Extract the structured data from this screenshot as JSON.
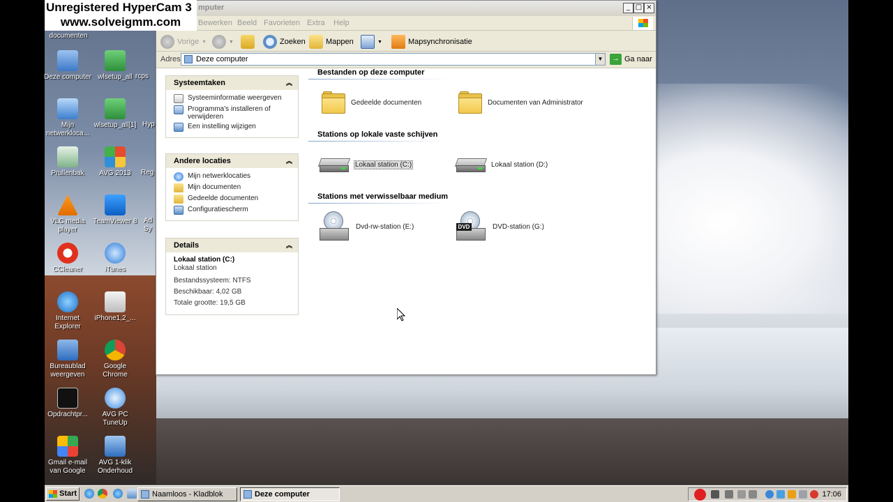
{
  "watermark": {
    "line1": "Unregistered HyperCam 3",
    "line2": "www.solveigmm.com"
  },
  "desktop": {
    "icons": [
      {
        "name": "desktop-icon-documenten",
        "label": "documenten"
      },
      {
        "name": "desktop-icon-deze-computer",
        "label": "Deze computer"
      },
      {
        "name": "desktop-icon-wlsetup-all",
        "label": "wlsetup_all"
      },
      {
        "name": "desktop-icon-rcps",
        "label": "rcps"
      },
      {
        "name": "desktop-icon-mijn-netwerk",
        "label": "Mijn netwerkloca..."
      },
      {
        "name": "desktop-icon-wlsetup-all-1",
        "label": "wlsetup_all[1]"
      },
      {
        "name": "desktop-icon-hyp",
        "label": "Hyp"
      },
      {
        "name": "desktop-icon-prullenbak",
        "label": "Prullenbak"
      },
      {
        "name": "desktop-icon-avg-2013",
        "label": "AVG 2013"
      },
      {
        "name": "desktop-icon-reg",
        "label": "Reg"
      },
      {
        "name": "desktop-icon-vlc",
        "label": "VLC media player"
      },
      {
        "name": "desktop-icon-teamviewer",
        "label": "TeamViewer 8"
      },
      {
        "name": "desktop-icon-ad",
        "label": "Ad Sy"
      },
      {
        "name": "desktop-icon-ccleaner",
        "label": "CCleaner"
      },
      {
        "name": "desktop-icon-itunes",
        "label": "iTunes"
      },
      {
        "name": "desktop-icon-internet-explorer",
        "label": "Internet Explorer"
      },
      {
        "name": "desktop-icon-iphone",
        "label": "iPhone1,2_..."
      },
      {
        "name": "desktop-icon-bureaublad",
        "label": "Bureaublad weergeven"
      },
      {
        "name": "desktop-icon-google-chrome",
        "label": "Google Chrome"
      },
      {
        "name": "desktop-icon-opdrachtprompt",
        "label": "Opdrachtpr..."
      },
      {
        "name": "desktop-icon-avg-tuneup",
        "label": "AVG PC TuneUp"
      },
      {
        "name": "desktop-icon-gmail",
        "label": "Gmail e-mail van Google"
      },
      {
        "name": "desktop-icon-avg-1klik",
        "label": "AVG 1-klik Onderhoud"
      }
    ]
  },
  "window": {
    "title": "mputer",
    "controls": {
      "minimize": "_",
      "maximize": "□",
      "close": "×"
    },
    "menu": {
      "bewerken": "Bewerken",
      "beeld": "Beeld",
      "favorieten": "Favorieten",
      "extra": "Extra",
      "help": "Help"
    },
    "toolbar": {
      "back": "Vorige",
      "search": "Zoeken",
      "folders": "Mappen",
      "sync": "Mapsynchronisatie"
    },
    "address": {
      "label": "Adres",
      "value": "Deze computer",
      "go": "Ga naar"
    },
    "tasks": {
      "system": {
        "title": "Systeemtaken",
        "links": [
          "Systeeminformatie weergeven",
          "Programma's installeren of verwijderen",
          "Een instelling wijzigen"
        ]
      },
      "other": {
        "title": "Andere locaties",
        "links": [
          "Mijn netwerklocaties",
          "Mijn documenten",
          "Gedeelde documenten",
          "Configuratiescherm"
        ]
      },
      "details": {
        "title": "Details",
        "name": "Lokaal station (C:)",
        "type": "Lokaal station",
        "fs": "Bestandssysteem: NTFS",
        "free": "Beschikbaar: 4,02 GB",
        "total": "Totale grootte: 19,5 GB"
      }
    },
    "sections": {
      "files": {
        "title": "Bestanden op deze computer",
        "items": [
          "Gedeelde documenten",
          "Documenten van Administrator"
        ]
      },
      "hdd": {
        "title": "Stations op lokale vaste schijven",
        "items": [
          "Lokaal station (C:)",
          "Lokaal station (D:)"
        ]
      },
      "removable": {
        "title": "Stations met verwisselbaar medium",
        "items": [
          "Dvd-rw-station (E:)",
          "DVD-station (G:)"
        ],
        "dvd_badge": "DVD"
      }
    }
  },
  "taskbar": {
    "start": "Start",
    "tasks": [
      "Naamloos - Kladblok",
      "Deze computer"
    ],
    "clock": "17:06"
  },
  "colors": {
    "accent": "#3b6aa3",
    "rec": "#e02020"
  }
}
